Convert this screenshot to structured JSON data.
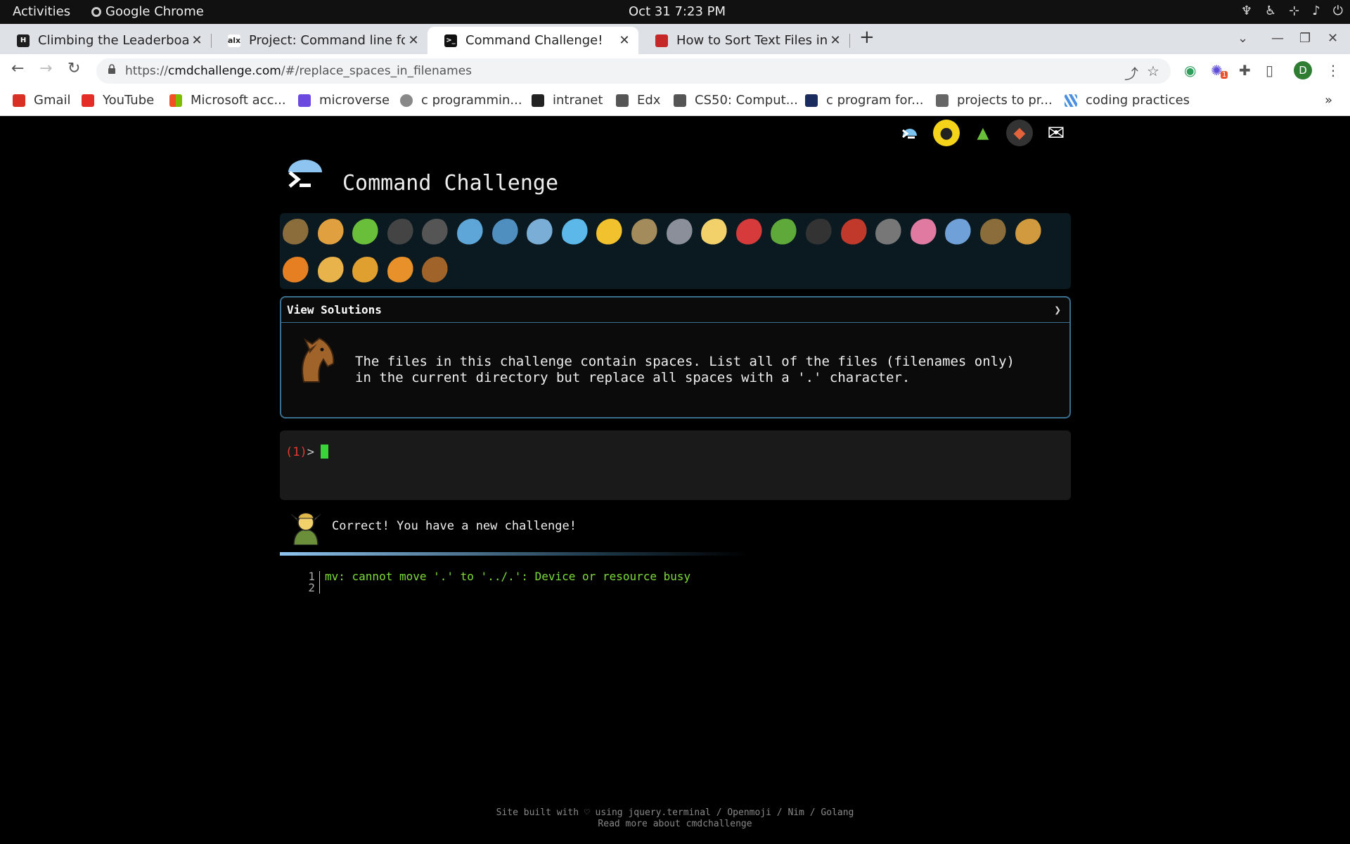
{
  "os": {
    "activities": "Activities",
    "app_name": "Google Chrome",
    "clock": "Oct 31  7:23 PM"
  },
  "tabs": [
    {
      "title": "Climbing the Leaderboard",
      "favicon": "hackerrank-icon",
      "active": false
    },
    {
      "title": "Project: Command line for",
      "favicon": "alx-icon",
      "active": false
    },
    {
      "title": "Command Challenge!",
      "favicon": "terminal-icon",
      "active": true
    },
    {
      "title": "How to Sort Text Files in L",
      "favicon": "news-icon",
      "active": false
    }
  ],
  "address_bar": {
    "url_prefix": "https://",
    "url_domain": "cmdchallenge.com",
    "url_path": "/#/replace_spaces_in_filenames"
  },
  "profile_initial": "D",
  "extension_badge": "1",
  "bookmarks": [
    {
      "label": "Gmail",
      "icon": "gmail-icon"
    },
    {
      "label": "YouTube",
      "icon": "youtube-icon"
    },
    {
      "label": "Microsoft acc...",
      "icon": "microsoft-icon"
    },
    {
      "label": "microverse",
      "icon": "microverse-icon"
    },
    {
      "label": "c programmin...",
      "icon": "globe-icon"
    },
    {
      "label": "intranet",
      "icon": "alx-icon"
    },
    {
      "label": "Edx",
      "icon": "edx-icon"
    },
    {
      "label": "CS50: Comput...",
      "icon": "edx-icon"
    },
    {
      "label": "c program for...",
      "icon": "sf-icon"
    },
    {
      "label": "projects to pr...",
      "icon": "folder-icon"
    },
    {
      "label": "coding practices",
      "icon": "stripes-icon"
    }
  ],
  "page": {
    "title": "Command Challenge",
    "view_solutions": "View Solutions",
    "chevron": "❯",
    "challenge_line1": "The files in this challenge contain spaces. List all of the files (filenames only)",
    "challenge_line2": "in the current directory but replace all spaces with a '.' character.",
    "prompt_num": "(1)",
    "prompt_symbol": ">",
    "result": "Correct! You have a new challenge!",
    "output_lines": [
      {
        "n": "1",
        "text": "mv: cannot move '.' to '../.': Device or resource busy"
      },
      {
        "n": "2",
        "text": ""
      }
    ],
    "footer_line1": "Site built with ♡ using jquery.terminal / Openmoji / Nim / Golang",
    "footer_line2": "Read more about cmdchallenge"
  },
  "animals": [
    {
      "name": "snail",
      "color": "#8a6d3b"
    },
    {
      "name": "butterfly",
      "color": "#e0a040"
    },
    {
      "name": "caterpillar",
      "color": "#6abf3a"
    },
    {
      "name": "ant",
      "color": "#444444"
    },
    {
      "name": "spider-web",
      "color": "#555555"
    },
    {
      "name": "whale",
      "color": "#5ea5d8"
    },
    {
      "name": "shark",
      "color": "#4f8fc0"
    },
    {
      "name": "dolphin",
      "color": "#7aaed6"
    },
    {
      "name": "fish",
      "color": "#5cb8e8"
    },
    {
      "name": "tropical-fish",
      "color": "#f2c12e"
    },
    {
      "name": "blowfish",
      "color": "#a38b5c"
    },
    {
      "name": "wolf",
      "color": "#8a8f99"
    },
    {
      "name": "bee",
      "color": "#f2d16b"
    },
    {
      "name": "ladybug",
      "color": "#d63a3a"
    },
    {
      "name": "cricket",
      "color": "#5fa83a"
    },
    {
      "name": "spider",
      "color": "#333333"
    },
    {
      "name": "scorpion",
      "color": "#c0392b"
    },
    {
      "name": "fly",
      "color": "#777777"
    },
    {
      "name": "worm",
      "color": "#e07aa0"
    },
    {
      "name": "microbe",
      "color": "#6fa0d8"
    },
    {
      "name": "monkey",
      "color": "#8a6d3b"
    },
    {
      "name": "dog",
      "color": "#d19a3e"
    },
    {
      "name": "fox",
      "color": "#e67e22"
    },
    {
      "name": "cat",
      "color": "#e8b34a"
    },
    {
      "name": "lion",
      "color": "#e0a030"
    },
    {
      "name": "tiger",
      "color": "#e8902a"
    },
    {
      "name": "horse",
      "color": "#a0642a"
    }
  ],
  "colors": {
    "accent_border": "#3a6f8f",
    "prompt_number": "#e53935",
    "cursor": "#39d439",
    "output_text": "#7ddc3a"
  }
}
